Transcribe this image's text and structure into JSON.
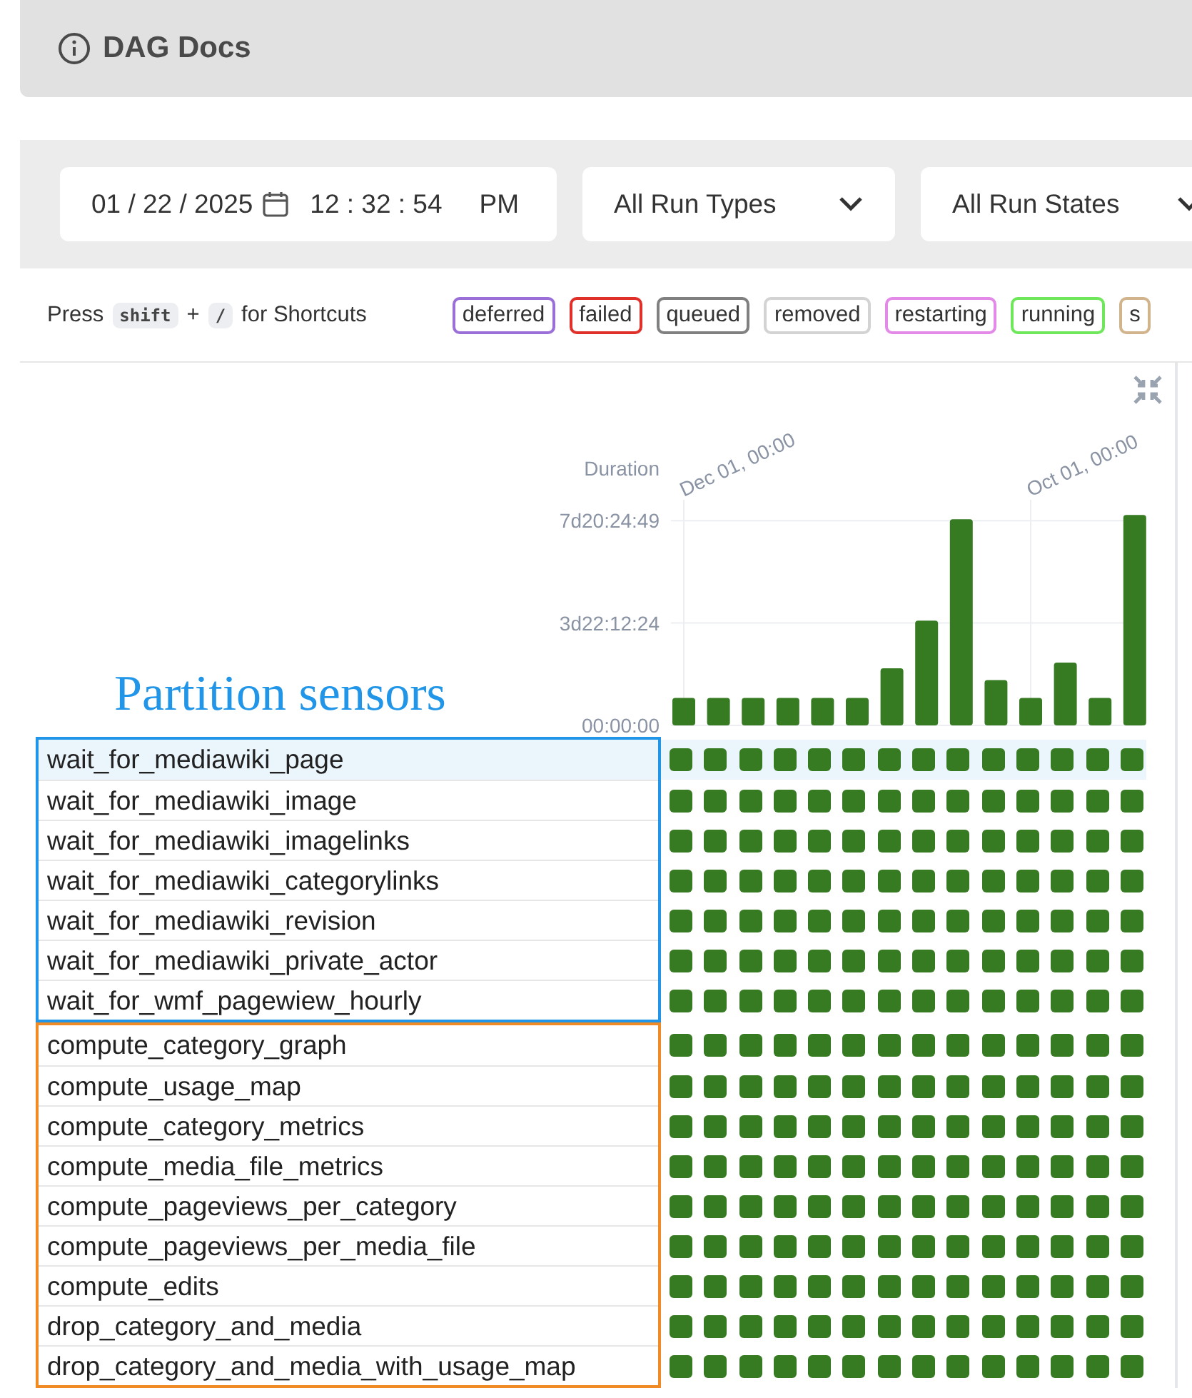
{
  "header": {
    "title": "DAG Docs"
  },
  "filters": {
    "datetime": {
      "date": "01 / 22 / 2025",
      "time": "12 : 32 : 54",
      "meridiem": "PM"
    },
    "run_type": "All Run Types",
    "run_state": "All Run States"
  },
  "shortcuts": {
    "prefix": "Press",
    "key1": "shift",
    "plus": "+",
    "key2": "/",
    "suffix": "for Shortcuts"
  },
  "legend": [
    {
      "label": "deferred",
      "color": "#9a6fd8"
    },
    {
      "label": "failed",
      "color": "#e0302a"
    },
    {
      "label": "queued",
      "color": "#808080"
    },
    {
      "label": "removed",
      "color": "#d3d3d3"
    },
    {
      "label": "restarting",
      "color": "#e389e8"
    },
    {
      "label": "running",
      "color": "#6ee85a"
    },
    {
      "label": "s",
      "color": "#d2b48c"
    }
  ],
  "chart": {
    "ylabel": "Duration",
    "y_labels": [
      "7d20:24:49",
      "3d22:12:24",
      "00:00:00"
    ],
    "x_labels": [
      "Dec 01, 00:00",
      "Oct 01, 00:00"
    ]
  },
  "task_groups": [
    {
      "label": "Partition sensors",
      "color": "#2196e8",
      "tasks": [
        {
          "name": "wait_for_mediawiki_page",
          "selected": true,
          "color": "#367a22"
        },
        {
          "name": "wait_for_mediawiki_image",
          "selected": false,
          "color": "#367a22"
        },
        {
          "name": "wait_for_mediawiki_imagelinks",
          "selected": false,
          "color": "#367a22"
        },
        {
          "name": "wait_for_mediawiki_categorylinks",
          "selected": false,
          "color": "#367a22"
        },
        {
          "name": "wait_for_mediawiki_revision",
          "selected": false,
          "color": "#367a22"
        },
        {
          "name": "wait_for_mediawiki_private_actor",
          "selected": false,
          "color": "#367a22"
        },
        {
          "name": "wait_for_wmf_pagewiew_hourly",
          "selected": false,
          "color": "#367a22"
        }
      ]
    },
    {
      "color": "#f08a24",
      "tasks": [
        {
          "name": "compute_category_graph",
          "selected": false,
          "color": "#367a22"
        },
        {
          "name": "compute_usage_map",
          "selected": false,
          "color": "#367a22"
        },
        {
          "name": "compute_category_metrics",
          "selected": false,
          "color": "#367a22"
        },
        {
          "name": "compute_media_file_metrics",
          "selected": false,
          "color": "#367a22"
        },
        {
          "name": "compute_pageviews_per_category",
          "selected": false,
          "color": "#367a22"
        },
        {
          "name": "compute_pageviews_per_media_file",
          "selected": false,
          "color": "#367a22"
        },
        {
          "name": "compute_edits",
          "selected": false,
          "color": "#367a22"
        },
        {
          "name": "drop_category_and_media",
          "selected": false,
          "color": "#367a22"
        },
        {
          "name": "drop_category_and_media_with_usage_map",
          "selected": false,
          "color": "#367a22"
        }
      ]
    }
  ]
}
